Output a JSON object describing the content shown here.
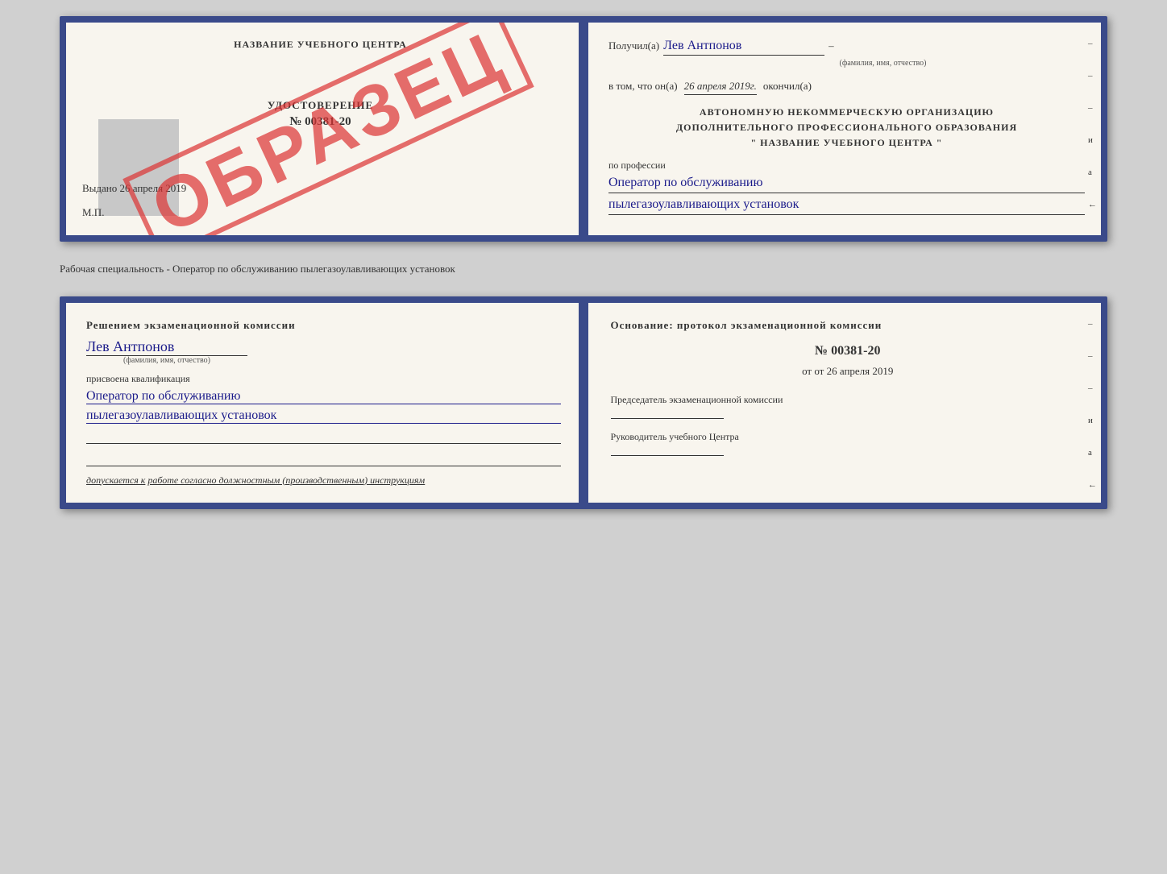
{
  "topBook": {
    "leftPage": {
      "headerLabel": "НАЗВАНИЕ УЧЕБНОГО ЦЕНТРА",
      "stampText": "ОБРАЗЕЦ",
      "udostTitle": "УДОСТОВЕРЕНИЕ",
      "udostNumber": "№ 00381-20",
      "vydanoLabel": "Выдано",
      "vydanoDate": "26 апреля 2019",
      "mpLabel": "М.П."
    },
    "rightPage": {
      "poluchilLabel": "Получил(а)",
      "poluchilName": "Лев Антпонов",
      "dashSymbol": "–",
      "fioLabel": "(фамилия, имя, отчество)",
      "vtomLabel": "в том, что он(а)",
      "vtomDate": "26 апреля 2019г.",
      "okonchilLabel": "окончил(а)",
      "orgLine1": "АВТОНОМНУЮ НЕКОММЕРЧЕСКУЮ ОРГАНИЗАЦИЮ",
      "orgLine2": "ДОПОЛНИТЕЛЬНОГО ПРОФЕССИОНАЛЬНОГО ОБРАЗОВАНИЯ",
      "orgLine3": "\"   НАЗВАНИЕ УЧЕБНОГО ЦЕНТРА   \"",
      "poProf": "по профессии",
      "profLine1": "Оператор по обслуживанию",
      "profLine2": "пылегазоулавливающих установок",
      "sideDashes": [
        "-",
        "-",
        "-",
        "и",
        "а",
        "←",
        "-",
        "-",
        "-",
        "-"
      ]
    }
  },
  "betweenText": "Рабочая специальность - Оператор по обслуживанию пылегазоулавливающих установок",
  "bottomBook": {
    "leftPage": {
      "resheniemText": "Решением экзаменационной комиссии",
      "nameBlue": "Лев Антпонов",
      "fioLabel": "(фамилия, имя, отчество)",
      "prisvoyenaText": "присвоена квалификация",
      "kvalifLine1": "Оператор по обслуживанию",
      "kvalifLine2": "пылегазоулавливающих установок",
      "dopuskaetsyaLabel": "допускается к",
      "dopuskaetsyaText": "работе согласно должностным (производственным) инструкциям"
    },
    "rightPage": {
      "osnovanie": "Основание: протокол экзаменационной комиссии",
      "protocolNumber": "№  00381-20",
      "otDate": "от 26 апреля 2019",
      "predsedatelLabel": "Председатель экзаменационной комиссии",
      "rukovoditelLabel": "Руководитель учебного Центра",
      "sideDashes": [
        "-",
        "-",
        "-",
        "и",
        "а",
        "←",
        "-",
        "-",
        "-",
        "-"
      ]
    }
  }
}
